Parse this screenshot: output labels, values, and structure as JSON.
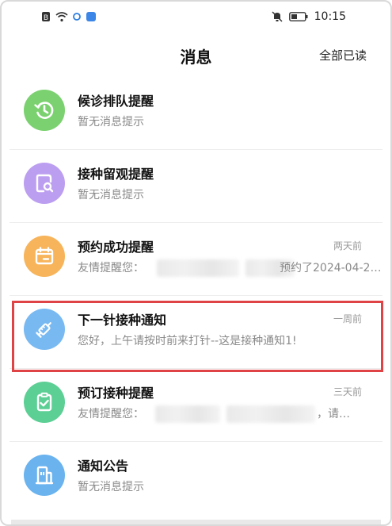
{
  "status": {
    "time": "10:15",
    "left_icons": [
      "sim-b-icon",
      "wifi-icon",
      "notification-dot-icon",
      "app-icon"
    ],
    "right_icons": [
      "mute-icon",
      "battery-icon"
    ]
  },
  "header": {
    "title": "消息",
    "mark_all_read": "全部已读"
  },
  "colors": {
    "green": "#7bd16f",
    "purple": "#bc9ef0",
    "orange": "#f7b45a",
    "blue": "#78b9f2",
    "teal": "#5ccf94",
    "sky": "#6ab3ef",
    "highlight": "#e04346"
  },
  "messages": [
    {
      "title": "候诊排队提醒",
      "time": "",
      "preview": "暂无消息提示",
      "icon": "queue-clock-icon"
    },
    {
      "title": "接种留观提醒",
      "time": "",
      "preview": "暂无消息提示",
      "icon": "document-search-icon"
    },
    {
      "title": "预约成功提醒",
      "time": "两天前",
      "preview_start": "友情提醒您：",
      "preview_end": "预约了2024-04-2…",
      "icon": "calendar-icon"
    },
    {
      "title": "下一针接种通知",
      "time": "一周前",
      "preview": "您好，上午请按时前来打针--这是接种通知1!",
      "icon": "syringe-icon"
    },
    {
      "title": "预订接种提醒",
      "time": "三天前",
      "preview_start": "友情提醒您：",
      "preview_end": "，请…",
      "icon": "clipboard-check-icon"
    },
    {
      "title": "通知公告",
      "time": "",
      "preview": "暂无消息提示",
      "icon": "building-icon"
    }
  ]
}
